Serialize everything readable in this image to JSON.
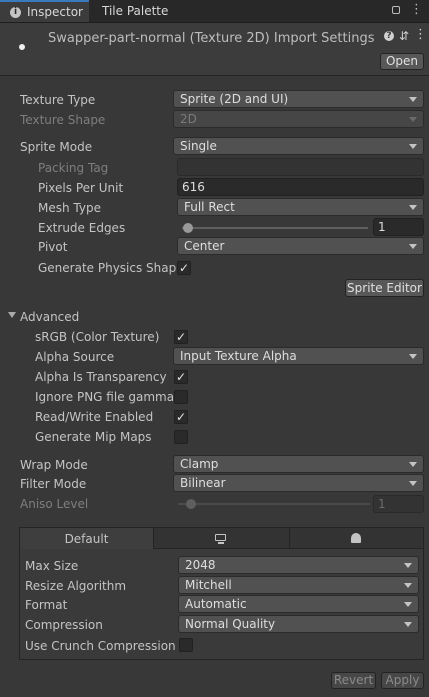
{
  "tabs": [
    {
      "label": "Inspector"
    },
    {
      "label": "Tile Palette"
    }
  ],
  "header": {
    "title": "Swapper-part-normal (Texture 2D) Import Settings",
    "open_label": "Open"
  },
  "fields": {
    "texture_type": {
      "label": "Texture Type",
      "value": "Sprite (2D and UI)"
    },
    "texture_shape": {
      "label": "Texture Shape",
      "value": "2D"
    },
    "sprite_mode": {
      "label": "Sprite Mode",
      "value": "Single"
    },
    "packing_tag": {
      "label": "Packing Tag",
      "value": ""
    },
    "pixels_per_unit": {
      "label": "Pixels Per Unit",
      "value": "616"
    },
    "mesh_type": {
      "label": "Mesh Type",
      "value": "Full Rect"
    },
    "extrude_edges": {
      "label": "Extrude Edges",
      "value": "1"
    },
    "pivot": {
      "label": "Pivot",
      "value": "Center"
    },
    "generate_physics_shape": {
      "label": "Generate Physics Shape",
      "checked": true
    },
    "sprite_editor_label": "Sprite Editor"
  },
  "advanced": {
    "label": "Advanced",
    "srgb": {
      "label": "sRGB (Color Texture)",
      "checked": true
    },
    "alpha_source": {
      "label": "Alpha Source",
      "value": "Input Texture Alpha"
    },
    "alpha_is_transparency": {
      "label": "Alpha Is Transparency",
      "checked": true
    },
    "ignore_png_gamma": {
      "label": "Ignore PNG file gamma",
      "checked": false
    },
    "read_write": {
      "label": "Read/Write Enabled",
      "checked": true
    },
    "generate_mip_maps": {
      "label": "Generate Mip Maps",
      "checked": false
    }
  },
  "wrap_mode": {
    "label": "Wrap Mode",
    "value": "Clamp"
  },
  "filter_mode": {
    "label": "Filter Mode",
    "value": "Bilinear"
  },
  "aniso_level": {
    "label": "Aniso Level",
    "value": "1"
  },
  "platform": {
    "tabs": [
      {
        "label": "Default",
        "icon": "monitor-icon"
      },
      {
        "icon": "monitor-icon"
      },
      {
        "icon": "android-icon"
      }
    ],
    "default_label": "Default",
    "max_size": {
      "label": "Max Size",
      "value": "2048"
    },
    "resize_algorithm": {
      "label": "Resize Algorithm",
      "value": "Mitchell"
    },
    "format": {
      "label": "Format",
      "value": "Automatic"
    },
    "compression": {
      "label": "Compression",
      "value": "Normal Quality"
    },
    "use_crunch": {
      "label": "Use Crunch Compression",
      "checked": false
    }
  },
  "footer": {
    "revert_label": "Revert",
    "apply_label": "Apply"
  },
  "colors": {
    "accent": "#3a79bb",
    "background": "#383838"
  }
}
